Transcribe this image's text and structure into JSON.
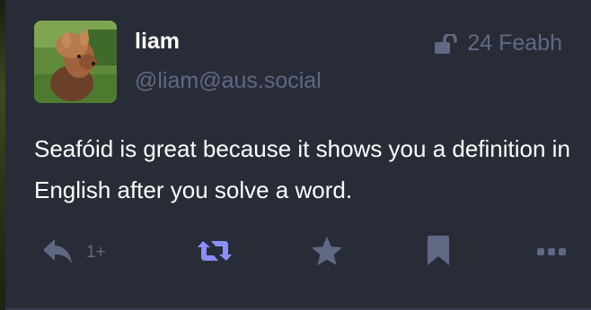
{
  "status": {
    "display_name": "liam",
    "acct": "@liam@aus.social",
    "visibility_icon": "unlock-icon",
    "timestamp": "24 Feabh",
    "content": "Seafóid is great because it shows you a definition in English after you solve a word.",
    "actions": {
      "reply_icon": "reply-icon",
      "reply_count": "1+",
      "boost_icon": "boost-icon",
      "boost_color": "#8c8dff",
      "favourite_icon": "star-icon",
      "bookmark_icon": "bookmark-icon",
      "more_icon": "more-icon"
    }
  },
  "colors": {
    "background": "#282c37",
    "muted": "#606984",
    "text": "#ffffff",
    "accent": "#8c8dff"
  }
}
